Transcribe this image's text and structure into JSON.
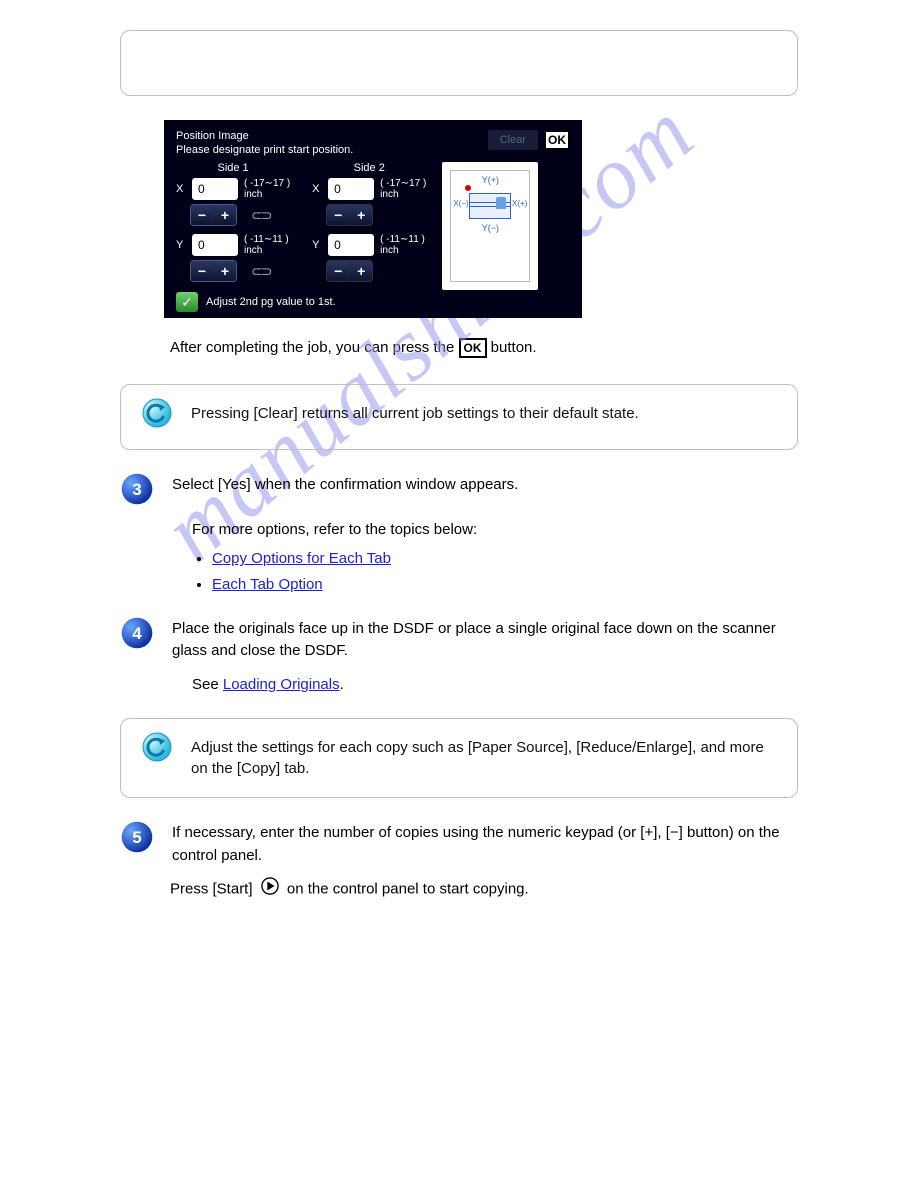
{
  "screenshot": {
    "title": "Position Image",
    "subtitle": "Please designate print start position.",
    "clear": "Clear",
    "ok": "OK",
    "side1": "Side 1",
    "side2": "Side 2",
    "axis_x": "X",
    "axis_y": "Y",
    "val_s1x": "0",
    "val_s1y": "0",
    "val_s2x": "0",
    "val_s2y": "0",
    "range_x": "( -17∼17 )",
    "range_y": "( -11∼11 )",
    "unit": "inch",
    "minus": "−",
    "plus": "+",
    "link": "⊂⊃",
    "adjust": "Adjust 2nd pg value to 1st.",
    "yplus": "Y(+)",
    "yminus": "Y(−)",
    "xplus": "X(+)",
    "xminus": "X(−)"
  },
  "after_shot_before": "After completing the job, you can press the",
  "after_shot_after": "button.",
  "hint1": "Pressing [Clear] returns all current job settings to their default state.",
  "step3": "Select [Yes] when the confirmation window appears.",
  "step3_sub_intro": "For more options, refer to the topics below:",
  "links": {
    "a": "Copy Options for Each Tab",
    "b": "Each Tab Option"
  },
  "step4": "Place the originals face up in the DSDF or place a single original face down on the scanner glass and close the DSDF.",
  "step4_sub_see": "See ",
  "step4_sub_link": "Loading Originals",
  "hint2": "Adjust the settings for each copy such as [Paper Source], [Reduce/Enlarge], and more on the [Copy] tab.",
  "step5": "If necessary, enter the number of copies using the numeric keypad (or [+], [−] button) on the control panel.",
  "continue_before": "Press [Start]",
  "continue_after": "on the control panel to start copying."
}
